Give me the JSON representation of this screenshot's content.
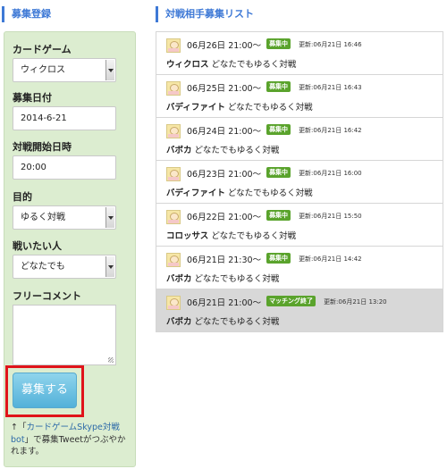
{
  "left_heading": "募集登録",
  "right_heading": "対戦相手募集リスト",
  "form": {
    "card_game_label": "カードゲーム",
    "card_game_value": "ウィクロス",
    "date_label": "募集日付",
    "date_value": "2014-6-21",
    "start_time_label": "対戦開始日時",
    "start_time_value": "20:00",
    "purpose_label": "目的",
    "purpose_value": "ゆるく対戦",
    "opponent_label": "戦いたい人",
    "opponent_value": "どなたでも",
    "comment_label": "フリーコメント",
    "submit_label": "募集する",
    "note_prefix": "↑「",
    "note_link": "カードゲームSkype対戦bot",
    "note_suffix": "」で募集Tweetがつぶやかれます。"
  },
  "listings": [
    {
      "datetime": "06月26日 21:00～",
      "status": "募集中",
      "updated": "更新:06月21日 16:46",
      "game": "ウィクロス",
      "text": "どなたでもゆるく対戦"
    },
    {
      "datetime": "06月25日 21:00～",
      "status": "募集中",
      "updated": "更新:06月21日 16:43",
      "game": "バディファイト",
      "text": "どなたでもゆるく対戦"
    },
    {
      "datetime": "06月24日 21:00～",
      "status": "募集中",
      "updated": "更新:06月21日 16:42",
      "game": "バボカ",
      "text": "どなたでもゆるく対戦"
    },
    {
      "datetime": "06月23日 21:00～",
      "status": "募集中",
      "updated": "更新:06月21日 16:00",
      "game": "バディファイト",
      "text": "どなたでもゆるく対戦"
    },
    {
      "datetime": "06月22日 21:00～",
      "status": "募集中",
      "updated": "更新:06月21日 15:50",
      "game": "コロッサス",
      "text": "どなたでもゆるく対戦"
    },
    {
      "datetime": "06月21日 21:30～",
      "status": "募集中",
      "updated": "更新:06月21日 14:42",
      "game": "バボカ",
      "text": "どなたでもゆるく対戦"
    },
    {
      "datetime": "06月21日 21:00～",
      "status": "マッチング終了",
      "updated": "更新:06月21日 13:20",
      "game": "バボカ",
      "text": "どなたでもゆるく対戦"
    }
  ],
  "colors": {
    "accent": "#3e79d6",
    "panel_bg": "#dcedd0",
    "badge_green": "#5aa32c",
    "highlight_red": "#e0141a",
    "button_blue": "#53b1d9"
  }
}
